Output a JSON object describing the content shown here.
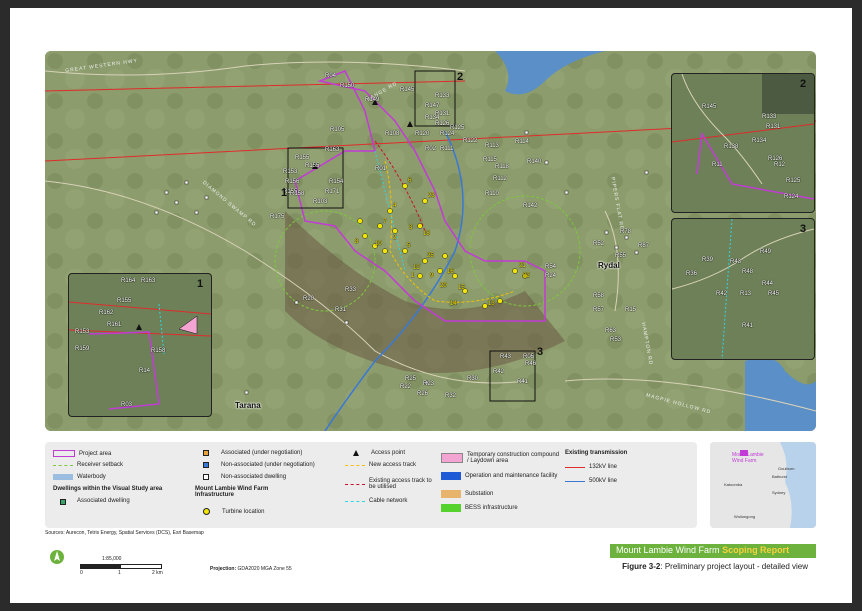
{
  "map": {
    "road_labels": [
      "GREAT WESTERN HWY",
      "RANGE RD",
      "DIAMOND SWAMP RD",
      "MAGPIE HOLLOW RD",
      "HAMPTON RD",
      "PIPERS FLAT RD",
      "SODWALLS RD"
    ],
    "towns": [
      "Rydal",
      "Tarana"
    ],
    "receivers": [
      "R04",
      "R150",
      "R145",
      "R149",
      "R133",
      "R147",
      "R131",
      "R155",
      "R126",
      "R134",
      "R120",
      "R124",
      "R122",
      "R113",
      "R114",
      "R115",
      "R112",
      "R110",
      "R118",
      "R103",
      "R155",
      "R163",
      "R154",
      "R153",
      "R156",
      "R155",
      "R175",
      "R158",
      "R171",
      "R142",
      "R140",
      "R111",
      "R105",
      "R108",
      "R125",
      "R01",
      "R02",
      "R20",
      "R33",
      "R31",
      "R52",
      "R55",
      "R54",
      "R58",
      "R57",
      "R63",
      "R78",
      "R87",
      "R25",
      "R22",
      "R23",
      "R26",
      "R30",
      "R32",
      "R43",
      "R05",
      "R42",
      "R46",
      "R41",
      "R24",
      "R15",
      "R53"
    ],
    "turbines": [
      "6",
      "23",
      "4",
      "18",
      "7",
      "3",
      "2",
      "8",
      "10",
      "5",
      "25",
      "1",
      "9",
      "16",
      "21",
      "22",
      "15",
      "13",
      "14",
      "12",
      "20"
    ],
    "colors": {
      "project_area": "#c23bd6",
      "line_132kv": "#e02b2b",
      "line_500kv": "#3a78d6",
      "receiver_setback": "#7cc83c",
      "new_track": "#f2c200",
      "existing_track": "#c8102e",
      "cable": "#2fd6e0",
      "turbine": "#f2e600",
      "water": "#5b8fc7"
    }
  },
  "insets": [
    {
      "num": "1",
      "labels": [
        "R164",
        "R163",
        "R155",
        "R162",
        "R161",
        "R153",
        "R159",
        "R158",
        "R14",
        "R03"
      ]
    },
    {
      "num": "2",
      "labels": [
        "R145",
        "R133",
        "R131",
        "R134",
        "R138",
        "R126",
        "R125",
        "R12",
        "R124",
        "R11"
      ]
    },
    {
      "num": "3",
      "labels": [
        "R39",
        "R49",
        "R43",
        "R36",
        "R48",
        "R44",
        "R42",
        "R13",
        "R45",
        "R41"
      ]
    }
  ],
  "legend": {
    "col1": [
      {
        "label": "Project area",
        "type": "project"
      },
      {
        "label": "Receiver setback",
        "type": "setback"
      },
      {
        "label": "Waterbody",
        "type": "water"
      }
    ],
    "dwellings_heading": "Dwellings within the Visual Study area",
    "col1b": [
      {
        "label": "Associated dwelling",
        "type": "assoc"
      }
    ],
    "col2": [
      {
        "label": "Associated (under negotiation)",
        "type": "assoc-neg"
      },
      {
        "label": "Non-associated (under negotiation)",
        "type": "nonassoc-neg"
      },
      {
        "label": "Non-associated dwelling",
        "type": "nonassoc"
      }
    ],
    "infra_heading": "Mount Lambie Wind Farm Infrastructure",
    "col2b": [
      {
        "label": "Turbine location",
        "type": "turbine"
      }
    ],
    "col3": [
      {
        "label": "Access point",
        "type": "access"
      },
      {
        "label": "New access track",
        "type": "newtrack"
      },
      {
        "label": "Existing access track to be utilised",
        "type": "exttrack"
      },
      {
        "label": "Cable network",
        "type": "cable"
      }
    ],
    "col4": [
      {
        "label": "Temporary construction compound / Laydown area",
        "type": "compound"
      },
      {
        "label": "Operation and maintenance facility",
        "type": "om"
      },
      {
        "label": "Substation",
        "type": "substation"
      },
      {
        "label": "BESS infrastructure",
        "type": "bess"
      }
    ],
    "transmission_heading": "Existing transmission",
    "col5": [
      {
        "label": "132kV line",
        "type": "kv132"
      },
      {
        "label": "500kV line",
        "type": "kv500"
      }
    ]
  },
  "locator": {
    "labels": [
      "Mount Lambie Wind Farm",
      "Goulburn",
      "Bathurst",
      "Katoomba",
      "Sydney",
      "Wollongong"
    ]
  },
  "sources": "Sources: Aurecon, Tetris Energy, Spatial Services (DCS), Esri Basemap",
  "scale": {
    "ratio": "1:85,000",
    "ticks": [
      "0",
      "1",
      "2 km"
    ]
  },
  "projection": {
    "label": "Projection:",
    "value": "GDA2020 MGA Zone 55"
  },
  "footer": {
    "title": "Mount Lambie Wind Farm",
    "report": "Scoping Report"
  },
  "caption": {
    "fig": "Figure 3-2",
    "text": ": Preliminary project layout - detailed view"
  }
}
